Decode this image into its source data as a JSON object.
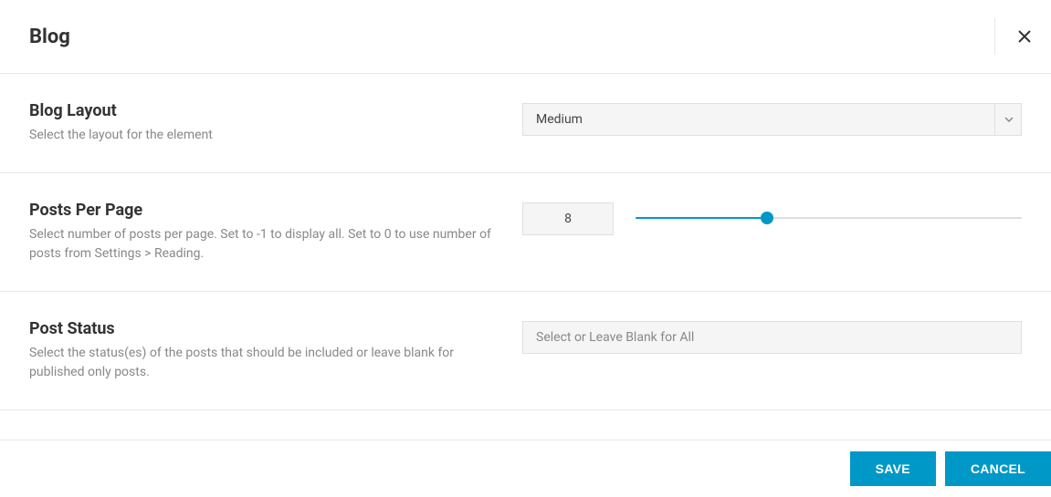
{
  "header": {
    "title": "Blog"
  },
  "sections": {
    "blog_layout": {
      "title": "Blog Layout",
      "desc": "Select the layout for the element",
      "value": "Medium"
    },
    "posts_per_page": {
      "title": "Posts Per Page",
      "desc": "Select number of posts per page. Set to -1 to display all. Set to 0 to use number of posts from Settings > Reading.",
      "value": "8"
    },
    "post_status": {
      "title": "Post Status",
      "desc": "Select the status(es) of the posts that should be included or leave blank for published only posts.",
      "placeholder": "Select or Leave Blank for All"
    }
  },
  "footer": {
    "save": "Save",
    "cancel": "Cancel"
  }
}
